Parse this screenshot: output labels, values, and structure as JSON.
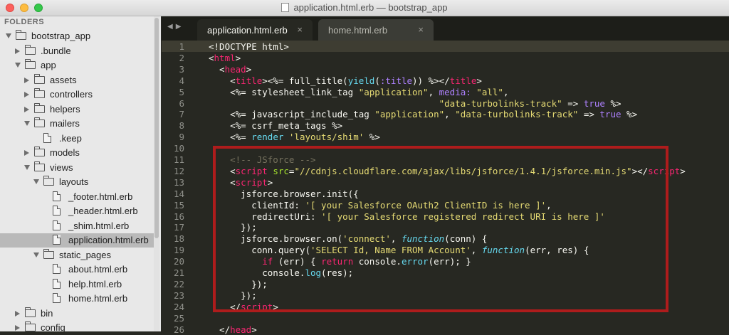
{
  "window": {
    "title": "application.html.erb — bootstrap_app"
  },
  "sidebar": {
    "header": "FOLDERS",
    "items": [
      {
        "label": "bootstrap_app",
        "type": "folder",
        "expanded": true,
        "depth": 0
      },
      {
        "label": ".bundle",
        "type": "folder",
        "expanded": false,
        "depth": 1
      },
      {
        "label": "app",
        "type": "folder",
        "expanded": true,
        "depth": 1
      },
      {
        "label": "assets",
        "type": "folder",
        "expanded": false,
        "depth": 2
      },
      {
        "label": "controllers",
        "type": "folder",
        "expanded": false,
        "depth": 2
      },
      {
        "label": "helpers",
        "type": "folder",
        "expanded": false,
        "depth": 2
      },
      {
        "label": "mailers",
        "type": "folder",
        "expanded": true,
        "depth": 2
      },
      {
        "label": ".keep",
        "type": "file",
        "depth": 3
      },
      {
        "label": "models",
        "type": "folder",
        "expanded": false,
        "depth": 2
      },
      {
        "label": "views",
        "type": "folder",
        "expanded": true,
        "depth": 2
      },
      {
        "label": "layouts",
        "type": "folder",
        "expanded": true,
        "depth": 3
      },
      {
        "label": "_footer.html.erb",
        "type": "file",
        "depth": 4
      },
      {
        "label": "_header.html.erb",
        "type": "file",
        "depth": 4
      },
      {
        "label": "_shim.html.erb",
        "type": "file",
        "depth": 4
      },
      {
        "label": "application.html.erb",
        "type": "file",
        "depth": 4,
        "selected": true
      },
      {
        "label": "static_pages",
        "type": "folder",
        "expanded": true,
        "depth": 3
      },
      {
        "label": "about.html.erb",
        "type": "file",
        "depth": 4
      },
      {
        "label": "help.html.erb",
        "type": "file",
        "depth": 4
      },
      {
        "label": "home.html.erb",
        "type": "file",
        "depth": 4
      },
      {
        "label": "bin",
        "type": "folder",
        "expanded": false,
        "depth": 1
      },
      {
        "label": "config",
        "type": "folder",
        "expanded": false,
        "depth": 1
      }
    ]
  },
  "tabs": [
    {
      "label": "application.html.erb",
      "active": true,
      "close": "×"
    },
    {
      "label": "home.html.erb",
      "active": false,
      "close": "×"
    }
  ],
  "editor": {
    "current_line": 1,
    "lines": [
      [
        [
          "",
          "<!DOCTYPE html>"
        ]
      ],
      [
        [
          "",
          "<"
        ],
        [
          "tg",
          "html"
        ],
        [
          "",
          ">"
        ]
      ],
      [
        [
          "",
          "  <"
        ],
        [
          "tg",
          "head"
        ],
        [
          "",
          ">"
        ]
      ],
      [
        [
          "",
          "    <"
        ],
        [
          "tg",
          "title"
        ],
        [
          "",
          ">"
        ],
        [
          "",
          "<%= full_title("
        ],
        [
          "bi",
          "yield"
        ],
        [
          "",
          "("
        ],
        [
          "sy",
          ":title"
        ],
        [
          "",
          ")) %>"
        ],
        [
          "",
          "</"
        ],
        [
          "tg",
          "title"
        ],
        [
          "",
          ">"
        ]
      ],
      [
        [
          "",
          "    <%= stylesheet_link_tag "
        ],
        [
          "st",
          "\"application\""
        ],
        [
          "",
          ", "
        ],
        [
          "sy",
          "media:"
        ],
        [
          "st",
          " \"all\""
        ],
        [
          "",
          ","
        ]
      ],
      [
        [
          "",
          "                                           "
        ],
        [
          "st",
          "\"data-turbolinks-track\""
        ],
        [
          "",
          " => "
        ],
        [
          "sy",
          "true"
        ],
        [
          "",
          " %>"
        ]
      ],
      [
        [
          "",
          "    <%= javascript_include_tag "
        ],
        [
          "st",
          "\"application\""
        ],
        [
          "",
          ", "
        ],
        [
          "st",
          "\"data-turbolinks-track\""
        ],
        [
          "",
          " => "
        ],
        [
          "sy",
          "true"
        ],
        [
          "",
          " %>"
        ]
      ],
      [
        [
          "",
          "    <%= csrf_meta_tags %>"
        ]
      ],
      [
        [
          "",
          "    <%= "
        ],
        [
          "cs",
          "render"
        ],
        [
          "st",
          " 'layouts/shim'"
        ],
        [
          "",
          " %>"
        ]
      ],
      [
        [
          "",
          ""
        ]
      ],
      [
        [
          "cm",
          "    <!-- JSforce -->"
        ]
      ],
      [
        [
          "",
          "    <"
        ],
        [
          "tg",
          "script"
        ],
        [
          "at",
          " src"
        ],
        [
          "",
          "="
        ],
        [
          "st",
          "\"//cdnjs.cloudflare.com/ajax/libs/jsforce/1.4.1/jsforce.min.js\""
        ],
        [
          "",
          "></"
        ],
        [
          "tg",
          "script"
        ],
        [
          "",
          ">"
        ]
      ],
      [
        [
          "",
          "    <"
        ],
        [
          "tg",
          "script"
        ],
        [
          "",
          ">"
        ]
      ],
      [
        [
          "",
          "      jsforce.browser.init({"
        ]
      ],
      [
        [
          "",
          "        clientId: "
        ],
        [
          "st",
          "'[ your Salesforce OAuth2 ClientID is here ]'"
        ],
        [
          "",
          ","
        ]
      ],
      [
        [
          "",
          "        redirectUri: "
        ],
        [
          "st",
          "'[ your Salesforce registered redirect URI is here ]'"
        ]
      ],
      [
        [
          "",
          "      });"
        ]
      ],
      [
        [
          "",
          "      jsforce.browser.on("
        ],
        [
          "st",
          "'connect'"
        ],
        [
          "",
          ", "
        ],
        [
          "fn",
          "function"
        ],
        [
          "",
          "(conn) {"
        ]
      ],
      [
        [
          "",
          "        conn.query("
        ],
        [
          "st",
          "'SELECT Id, Name FROM Account'"
        ],
        [
          "",
          ", "
        ],
        [
          "fn",
          "function"
        ],
        [
          "",
          "(err, res) {"
        ]
      ],
      [
        [
          "",
          "          "
        ],
        [
          "kw",
          "if"
        ],
        [
          "",
          " (err) { "
        ],
        [
          "kw",
          "return"
        ],
        [
          "",
          " console."
        ],
        [
          "cs",
          "error"
        ],
        [
          "",
          "(err); }"
        ]
      ],
      [
        [
          "",
          "          console."
        ],
        [
          "cs",
          "log"
        ],
        [
          "",
          "(res);"
        ]
      ],
      [
        [
          "",
          "        });"
        ]
      ],
      [
        [
          "",
          "      });"
        ]
      ],
      [
        [
          "",
          "    </"
        ],
        [
          "tg",
          "script"
        ],
        [
          "",
          ">"
        ]
      ],
      [
        [
          "",
          ""
        ]
      ],
      [
        [
          "",
          "  </"
        ],
        [
          "tg",
          "head"
        ],
        [
          "",
          ">"
        ]
      ]
    ]
  },
  "colors": {
    "annotation_box": "#ae1c1c",
    "editor_bg": "#272822",
    "sidebar_bg": "#e8e8e8"
  }
}
